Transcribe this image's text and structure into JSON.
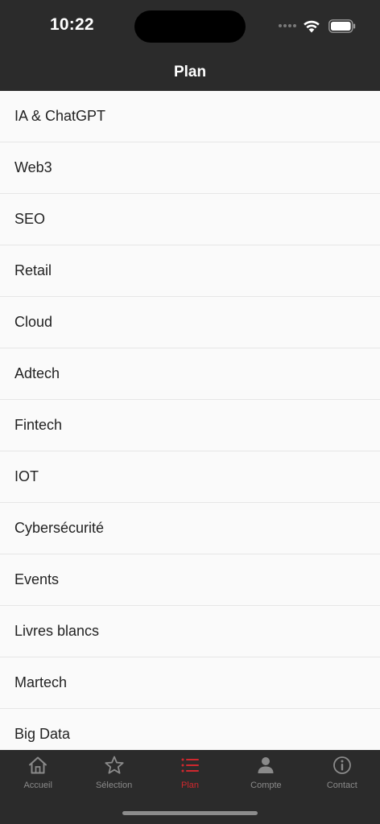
{
  "status_bar": {
    "time": "10:22"
  },
  "nav": {
    "title": "Plan"
  },
  "list": {
    "items": [
      {
        "label": "IA & ChatGPT"
      },
      {
        "label": "Web3"
      },
      {
        "label": "SEO"
      },
      {
        "label": "Retail"
      },
      {
        "label": "Cloud"
      },
      {
        "label": "Adtech"
      },
      {
        "label": "Fintech"
      },
      {
        "label": "IOT"
      },
      {
        "label": "Cybersécurité"
      },
      {
        "label": "Events"
      },
      {
        "label": "Livres blancs"
      },
      {
        "label": "Martech"
      },
      {
        "label": "Big Data"
      }
    ]
  },
  "tab_bar": {
    "active_color": "#d0282e",
    "inactive_color": "#8a8a8a",
    "tabs": [
      {
        "label": "Accueil",
        "icon": "home-icon"
      },
      {
        "label": "Sélection",
        "icon": "star-icon"
      },
      {
        "label": "Plan",
        "icon": "list-icon",
        "active": true
      },
      {
        "label": "Compte",
        "icon": "person-icon"
      },
      {
        "label": "Contact",
        "icon": "info-icon"
      }
    ]
  }
}
